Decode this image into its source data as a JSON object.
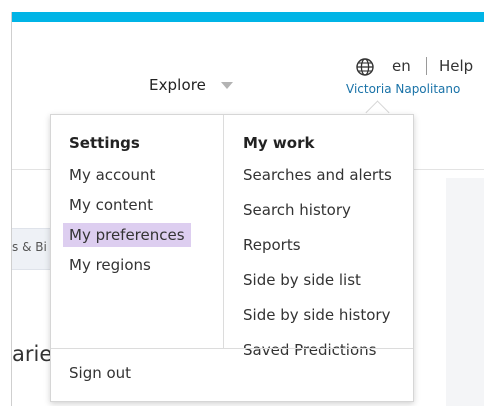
{
  "header": {
    "explore_label": "Explore",
    "language": "en",
    "help_label": "Help",
    "user_name": "Victoria Napolitano"
  },
  "background": {
    "crumb_fragment": "s & Bi",
    "heading_fragment": "aries"
  },
  "dropdown": {
    "settings": {
      "title": "Settings",
      "items": [
        {
          "label": "My account"
        },
        {
          "label": "My content"
        },
        {
          "label": "My preferences",
          "highlighted": true
        },
        {
          "label": "My regions"
        }
      ]
    },
    "my_work": {
      "title": "My work",
      "items": [
        {
          "label": "Searches and alerts"
        },
        {
          "label": "Search history"
        },
        {
          "label": "Reports"
        },
        {
          "label": "Side by side list"
        },
        {
          "label": "Side by side history"
        },
        {
          "label": "Saved Predictions"
        }
      ]
    },
    "sign_out_label": "Sign out"
  },
  "colors": {
    "accent_strip": "#00b4e6",
    "link": "#1a73a8",
    "highlight": "#ddcef0"
  },
  "icons": {
    "language": "globe-icon",
    "explore_caret": "caret-down-icon"
  }
}
